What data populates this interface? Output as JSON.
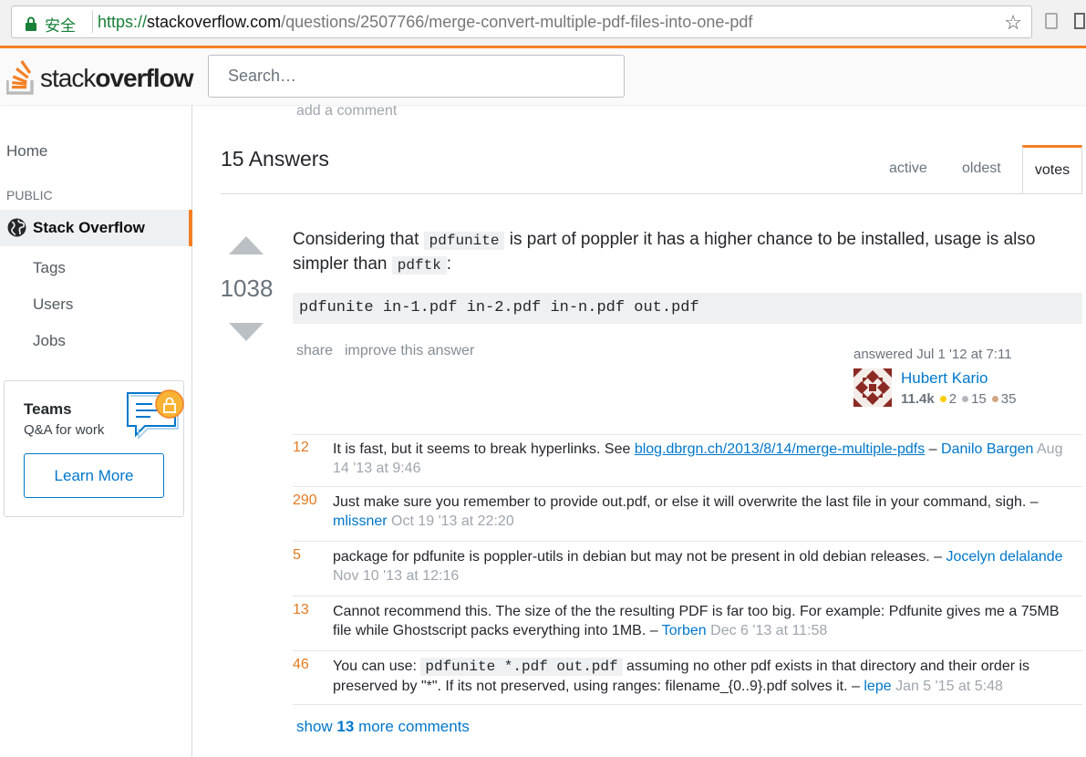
{
  "browser": {
    "secure_label": "安全",
    "url_scheme": "https://",
    "url_host": "stackoverflow.com",
    "url_path": "/questions/2507766/merge-convert-multiple-pdf-files-into-one-pdf"
  },
  "topbar": {
    "logo_light": "stack",
    "logo_bold": "overflow",
    "search_placeholder": "Search…"
  },
  "sidebar": {
    "home": "Home",
    "public": "PUBLIC",
    "stack_overflow": "Stack Overflow",
    "tags": "Tags",
    "users": "Users",
    "jobs": "Jobs",
    "teams_title": "Teams",
    "teams_sub": "Q&A for work",
    "learn_more": "Learn More"
  },
  "question": {
    "add_comment": "add a comment"
  },
  "answers": {
    "count_label": "15 Answers",
    "tabs": [
      "active",
      "oldest",
      "votes"
    ]
  },
  "answer": {
    "score": "1038",
    "text_1": "Considering that ",
    "code_1": "pdfunite",
    "text_2": " is part of poppler it has a higher chance to be installed, usage is also simpler than ",
    "code_2": "pdftk",
    "text_3": ":",
    "code_block": "pdfunite in-1.pdf in-2.pdf in-n.pdf out.pdf",
    "share": "share",
    "improve": "improve this answer",
    "answered": "answered Jul 1 '12 at 7:11",
    "user_name": "Hubert Kario",
    "user_rep": "11.4k",
    "badges_gold": "2",
    "badges_silver": "15",
    "badges_bronze": "35"
  },
  "comments": [
    {
      "score": "12",
      "text": "It is fast, but it seems to break hyperlinks. See ",
      "link": "blog.dbrgn.ch/2013/8/14/merge-multiple-pdfs",
      "sep": " – ",
      "user": "Danilo Bargen",
      "date": "Aug 14 '13 at 9:46"
    },
    {
      "score": "290",
      "text": "Just make sure you remember to provide out.pdf, or else it will overwrite the last file in your command, sigh.",
      "sep": " – ",
      "user": "mlissner",
      "date": "Oct 19 '13 at 22:20"
    },
    {
      "score": "5",
      "text": "package for pdfunite is poppler-utils in debian but may not be present in old debian releases.",
      "sep": " – ",
      "user": "Jocelyn delalande",
      "date": "Nov 10 '13 at 12:16"
    },
    {
      "score": "13",
      "text": "Cannot recommend this. The size of the the resulting PDF is far too big. For example: Pdfunite gives me a 75MB file while Ghostscript packs everything into 1MB.",
      "sep": " – ",
      "user": "Torben",
      "date": "Dec 6 '13 at 11:58"
    },
    {
      "score": "46",
      "text_a": "You can use: ",
      "code": "pdfunite *.pdf out.pdf",
      "text_b": " assuming no other pdf exists in that directory and their order is preserved by \"*\". If its not preserved, using ranges: filename_{0..9}.pdf solves it.",
      "sep": " – ",
      "user": "lepe",
      "date": "Jan 5 '15 at 5:48"
    }
  ],
  "show_more": {
    "prefix": "show ",
    "count": "13",
    "suffix": " more comments"
  },
  "colors": {
    "accent": "#f48024",
    "link": "#0077cc",
    "comment_score": "#e17b22"
  }
}
